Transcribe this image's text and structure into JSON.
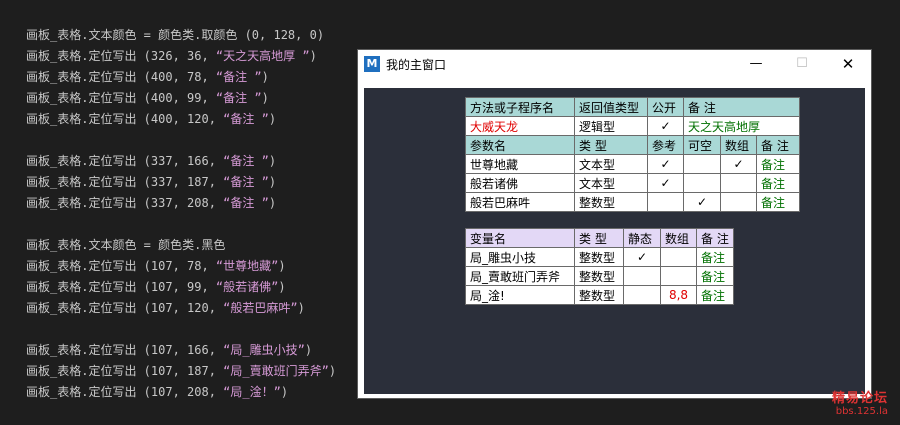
{
  "code_lines": [
    {
      "pre": "画板_表格.文本颜色 = 颜色类.取颜色 (0, 128, 0)",
      "str": "",
      "post": ""
    },
    {
      "pre": "画板_表格.定位写出 (326, 36, ",
      "str": "“天之天高地厚 ”",
      "post": ")"
    },
    {
      "pre": "画板_表格.定位写出 (400, 78, ",
      "str": "“备注 ”",
      "post": ")"
    },
    {
      "pre": "画板_表格.定位写出 (400, 99, ",
      "str": "“备注 ”",
      "post": ")"
    },
    {
      "pre": "画板_表格.定位写出 (400, 120, ",
      "str": "“备注 ”",
      "post": ")"
    },
    {
      "gap": true
    },
    {
      "pre": "画板_表格.定位写出 (337, 166, ",
      "str": "“备注 ”",
      "post": ")"
    },
    {
      "pre": "画板_表格.定位写出 (337, 187, ",
      "str": "“备注 ”",
      "post": ")"
    },
    {
      "pre": "画板_表格.定位写出 (337, 208, ",
      "str": "“备注 ”",
      "post": ")"
    },
    {
      "gap": true
    },
    {
      "pre": "画板_表格.文本颜色 = 颜色类.黑色",
      "str": "",
      "post": ""
    },
    {
      "pre": "画板_表格.定位写出 (107, 78, ",
      "str": "“世尊地藏”",
      "post": ")"
    },
    {
      "pre": "画板_表格.定位写出 (107, 99, ",
      "str": "“般若诸佛”",
      "post": ")"
    },
    {
      "pre": "画板_表格.定位写出 (107, 120, ",
      "str": "“般若巴麻吽”",
      "post": ")"
    },
    {
      "gap": true
    },
    {
      "pre": "画板_表格.定位写出 (107, 166, ",
      "str": "“局_雕虫小技”",
      "post": ")"
    },
    {
      "pre": "画板_表格.定位写出 (107, 187, ",
      "str": "“局_賣敢班门弄斧”",
      "post": ")"
    },
    {
      "pre": "画板_表格.定位写出 (107, 208, ",
      "str": "“局_淦！”",
      "post": ")"
    }
  ],
  "window": {
    "icon_letter": "M",
    "title": "我的主窗口",
    "min": "—",
    "max": "☐",
    "close": "✕"
  },
  "table1": {
    "header": [
      "方法或子程序名",
      "返回值类型",
      "公开",
      "备 注"
    ],
    "method": [
      "大威天龙",
      "逻辑型",
      "✓",
      "天之天高地厚"
    ],
    "param_header": [
      "参数名",
      "类 型",
      "参考",
      "可空",
      "数组",
      "备 注"
    ],
    "params": [
      [
        "世尊地藏",
        "文本型",
        "✓",
        "",
        "✓",
        "备注"
      ],
      [
        "般若诸佛",
        "文本型",
        "✓",
        "",
        "",
        "备注"
      ],
      [
        "般若巴麻吽",
        "整数型",
        "",
        "✓",
        "",
        "备注"
      ]
    ]
  },
  "table2": {
    "header": [
      "变量名",
      "类 型",
      "静态",
      "数组",
      "备 注"
    ],
    "rows": [
      [
        "局_雕虫小技",
        "整数型",
        "✓",
        "",
        "备注"
      ],
      [
        "局_賣敢班门弄斧",
        "整数型",
        "",
        "",
        "备注"
      ],
      [
        "局_淦!",
        "整数型",
        "",
        "8,8",
        "备注"
      ]
    ]
  },
  "watermark": {
    "main": "精易论坛",
    "sub": "bbs.125.la"
  },
  "colors": {
    "bg": "#1e1e1e",
    "string": "#d69ad6",
    "table1_header": "#a9d8d6",
    "table2_header": "#e3d8f6",
    "client": "#2b2f3a"
  }
}
